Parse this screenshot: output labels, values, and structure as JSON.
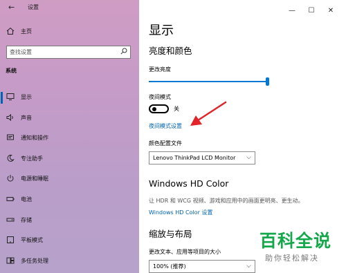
{
  "window": {
    "title": "设置",
    "controls": {
      "minimize": "—",
      "maximize": "☐",
      "close": "✕"
    }
  },
  "sidebar": {
    "home_label": "主页",
    "search_placeholder": "查找设置",
    "section_heading": "系统",
    "items": [
      {
        "label": "显示",
        "icon": "monitor-icon",
        "active": true
      },
      {
        "label": "声音",
        "icon": "speaker-icon"
      },
      {
        "label": "通知和操作",
        "icon": "notification-icon"
      },
      {
        "label": "专注助手",
        "icon": "moon-icon"
      },
      {
        "label": "电源和睡眠",
        "icon": "power-icon"
      },
      {
        "label": "电池",
        "icon": "battery-icon"
      },
      {
        "label": "存储",
        "icon": "storage-icon"
      },
      {
        "label": "平板模式",
        "icon": "tablet-icon"
      },
      {
        "label": "多任务处理",
        "icon": "multitask-icon"
      }
    ]
  },
  "main": {
    "page_title": "显示",
    "brightness_section": "亮度和颜色",
    "brightness_label": "更改亮度",
    "brightness_level": 1.0,
    "night_light_label": "夜间模式",
    "night_light_state": "关",
    "night_light_settings_link": "夜间模式设置",
    "color_profile_label": "颜色配置文件",
    "color_profile_value": "Lenovo ThinkPad LCD Monitor",
    "hd_color_heading": "Windows HD Color",
    "hd_color_desc": "让 HDR 和 WCG 视频、游戏和应用中的画面更明亮、更生动。",
    "hd_color_link": "Windows HD Color 设置",
    "scale_heading": "缩放与布局",
    "scale_label": "更改文本、应用等项目的大小",
    "scale_value": "100% (推荐)"
  },
  "watermark": {
    "logo": "百科全说",
    "tagline": "助你轻松解决"
  },
  "colors": {
    "accent": "#0078d7",
    "link": "#0063b1",
    "annotation_arrow": "#e0242a",
    "watermark_green": "#14a84b"
  }
}
